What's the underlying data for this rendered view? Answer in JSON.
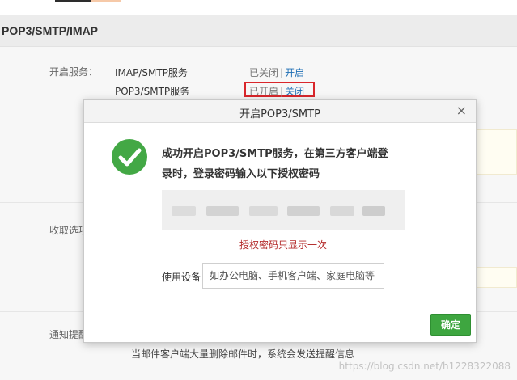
{
  "section": {
    "title": "POP3/SMTP/IMAP"
  },
  "service_label": "开启服务：",
  "services": [
    {
      "name": "IMAP/SMTP服务",
      "status": "已关闭",
      "action": "开启"
    },
    {
      "name": "POP3/SMTP服务",
      "status": "已开启",
      "action": "关闭"
    }
  ],
  "receive_label": "收取选项",
  "notify_label": "通知提醒",
  "footer_text": "当邮件客户端大量删除邮件时，系统会发送提醒信息",
  "watermark": "https://blog.csdn.net/h1228322088",
  "modal": {
    "title": "开启POP3/SMTP",
    "close": "×",
    "success_line1": "成功开启POP3/SMTP服务，在第三方客户端登",
    "success_line2": "录时，登录密码输入以下授权密码",
    "code_note": "授权密码只显示一次",
    "device_label": "使用设备",
    "device_placeholder": "如办公电脑、手机客户端、家庭电脑等",
    "confirm": "确定"
  },
  "colors": {
    "accent_green": "#3ea640",
    "link_blue": "#1f6fb5",
    "warn_red": "#d9262b"
  }
}
